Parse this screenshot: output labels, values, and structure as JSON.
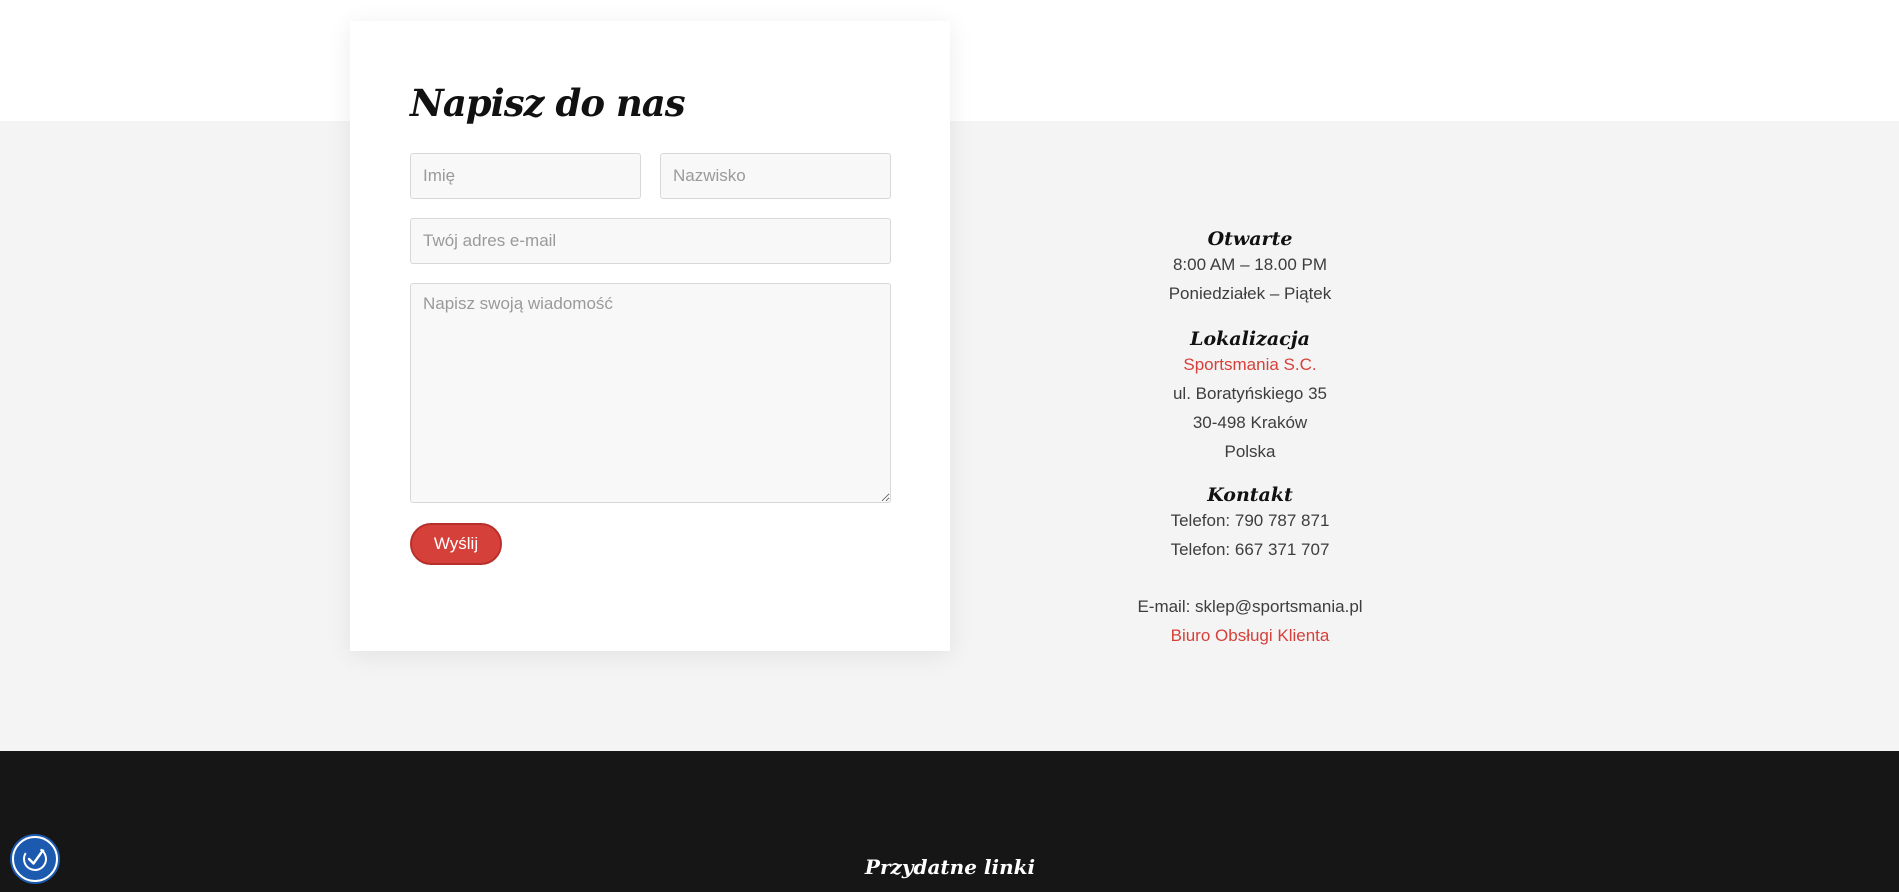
{
  "contact_form": {
    "title": "Napisz do nas",
    "first_name_placeholder": "Imię",
    "last_name_placeholder": "Nazwisko",
    "email_placeholder": "Twój adres e-mail",
    "message_placeholder": "Napisz swoją wiadomość",
    "submit_label": "Wyślij"
  },
  "info": {
    "hours_heading": "Otwarte",
    "hours_time": "8:00 AM – 18.00 PM",
    "hours_days": "Poniedziałek – Piątek",
    "location_heading": "Lokalizacja",
    "company_link": "Sportsmania S.C.",
    "street": "ul. Boratyńskiego 35",
    "city": "30-498 Kraków",
    "country": "Polska",
    "contact_heading": "Kontakt",
    "phone_1": "Telefon: 790 787 871",
    "phone_2": "Telefon: 667 371 707",
    "email": "E-mail: sklep@sportsmania.pl",
    "support_link": "Biuro Obsługi Klienta"
  },
  "footer": {
    "useful_links_heading": "Przydatne linki",
    "second_heading": ""
  },
  "icons": {
    "accessibility": "accessibility-icon"
  },
  "colors": {
    "accent": "#d6403a",
    "footer_bg": "#161616",
    "section_bg": "#f4f4f4",
    "a11y_blue": "#1c5ab0"
  }
}
